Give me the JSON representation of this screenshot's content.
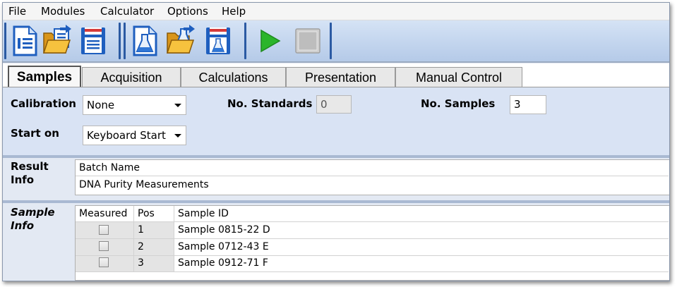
{
  "menu": {
    "items": [
      "File",
      "Modules",
      "Calculator",
      "Options",
      "Help"
    ]
  },
  "toolbar": {
    "buttons": [
      "new-report-icon",
      "open-folder-icon",
      "save-report-icon",
      "new-method-icon",
      "open-method-icon",
      "save-method-icon",
      "run-play-icon",
      "stop-icon"
    ],
    "colors": {
      "blue": "#1f5fbf",
      "play": "#2bb52b",
      "folder": "#f2b11c"
    }
  },
  "tabs": [
    "Samples",
    "Acquisition",
    "Calculations",
    "Presentation",
    "Manual Control"
  ],
  "settings": {
    "calibration_label": "Calibration",
    "calibration_value": "None",
    "start_label": "Start on",
    "start_value": "Keyboard Start",
    "standards_label": "No. Standards",
    "standards_value": "0",
    "samples_label": "No. Samples",
    "samples_value": "3"
  },
  "result": {
    "label_line1": "Result",
    "label_line2": "Info",
    "header": "Batch Name",
    "value": "DNA Purity Measurements"
  },
  "samples": {
    "label_line1": "Sample",
    "label_line2": "Info",
    "columns": [
      "Measured",
      "Pos",
      "Sample ID"
    ],
    "rows": [
      {
        "measured": false,
        "pos": "1",
        "id": "Sample 0815-22 D"
      },
      {
        "measured": false,
        "pos": "2",
        "id": "Sample 0712-43 E"
      },
      {
        "measured": false,
        "pos": "3",
        "id": "Sample 0912-71 F"
      }
    ]
  }
}
